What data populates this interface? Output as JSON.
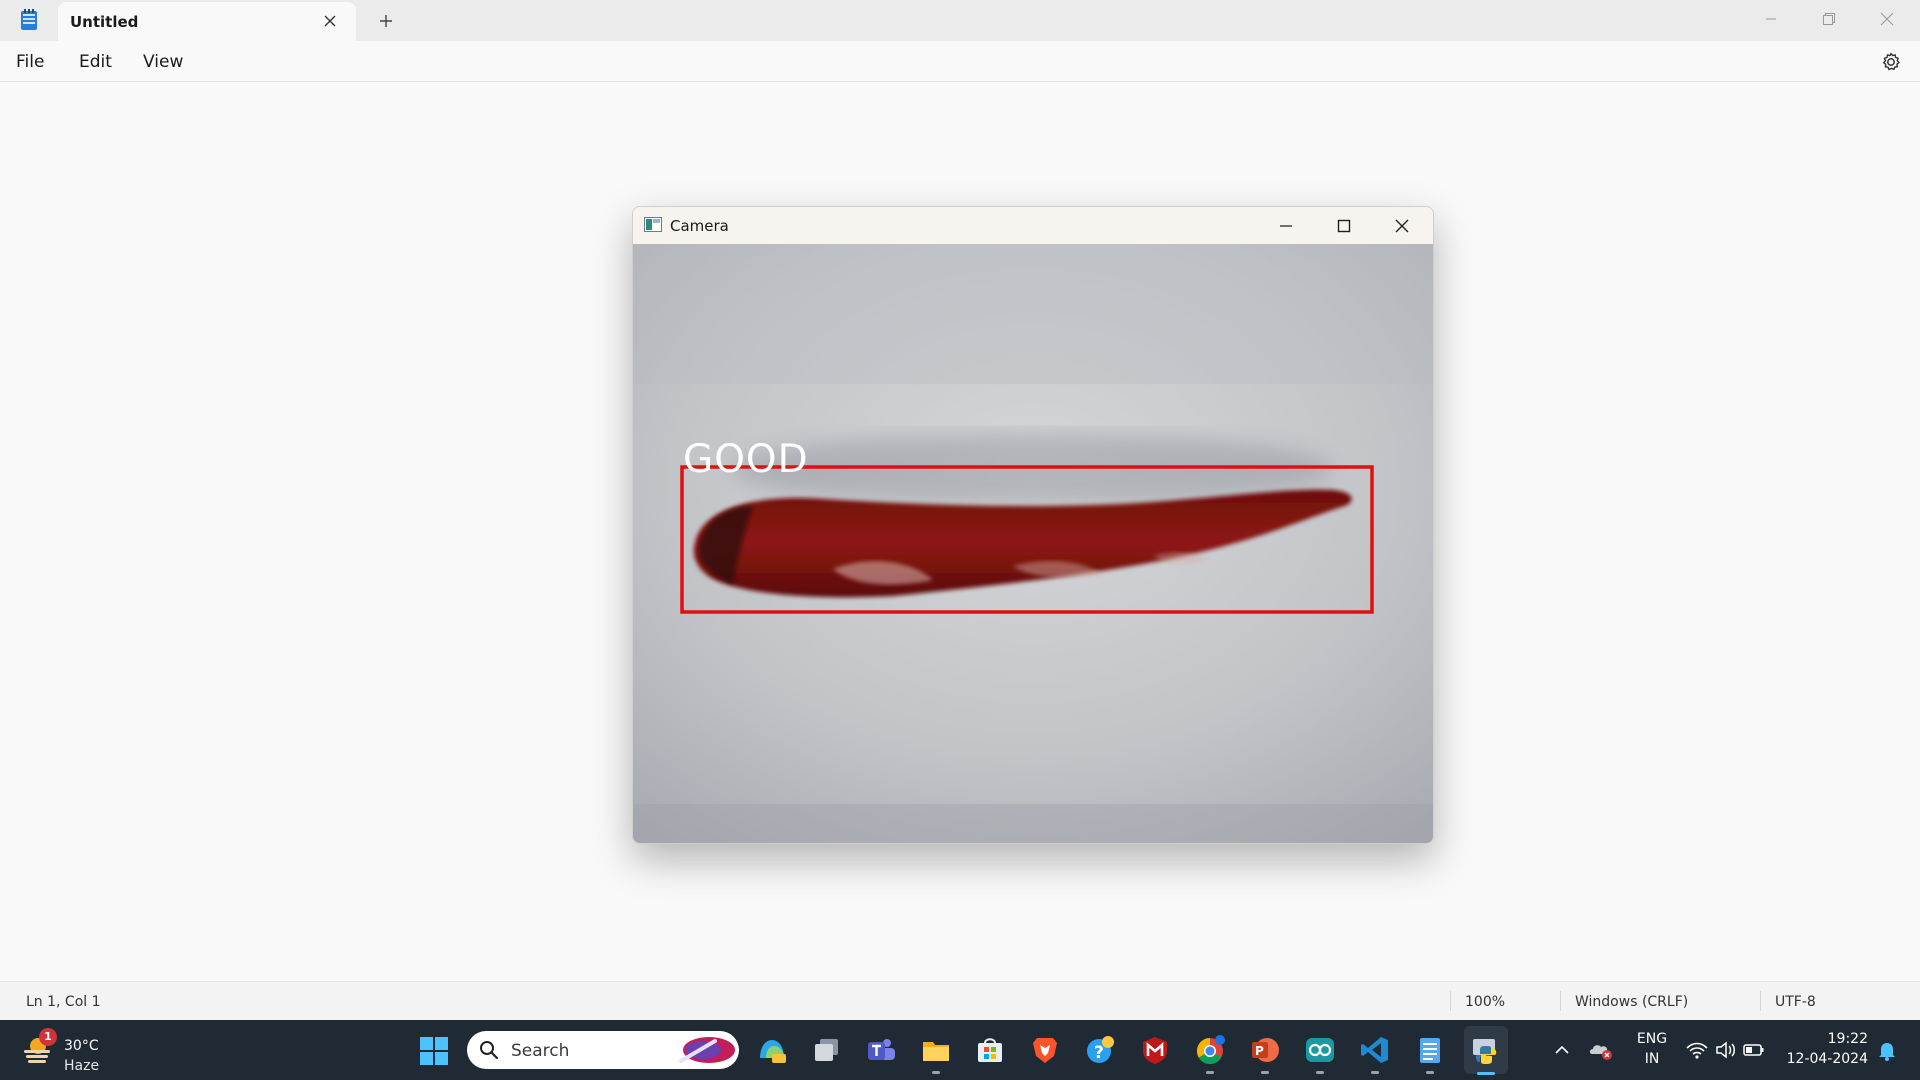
{
  "notepad": {
    "tab_title": "Untitled",
    "menu": [
      "File",
      "Edit",
      "View"
    ],
    "status": {
      "position": "Ln 1, Col 1",
      "zoom": "100%",
      "line_ending": "Windows (CRLF)",
      "encoding": "UTF-8"
    }
  },
  "camera_window": {
    "title": "Camera",
    "detection_label": "GOOD",
    "box_color": "#e01010"
  },
  "taskbar": {
    "weather": {
      "badge": "1",
      "temperature": "30°C",
      "condition": "Haze"
    },
    "search_placeholder": "Search",
    "pinned_apps": [
      "copilot-icon",
      "task-view-icon",
      "teams-icon",
      "file-explorer-icon",
      "microsoft-store-icon",
      "brave-icon",
      "help-icon",
      "mcafee-icon",
      "chrome-icon",
      "powerpoint-icon",
      "arduino-icon",
      "vscode-icon",
      "notepad-icon",
      "python-icon"
    ],
    "tray": {
      "language_line1": "ENG",
      "language_line2": "IN",
      "time": "19:22",
      "date": "12-04-2024"
    }
  }
}
